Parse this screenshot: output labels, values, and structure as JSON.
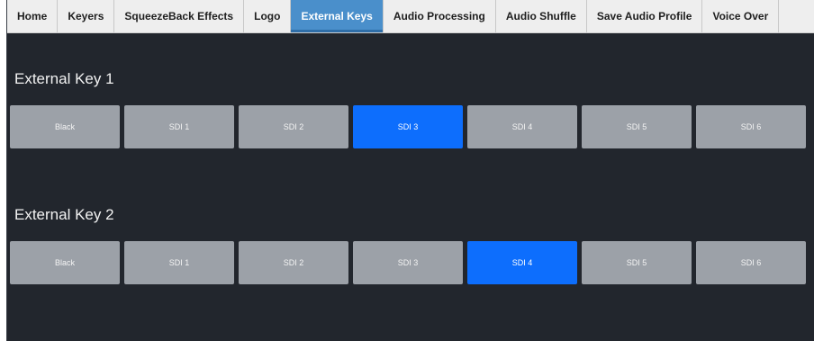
{
  "tabs": [
    {
      "label": "Home",
      "active": false
    },
    {
      "label": "Keyers",
      "active": false
    },
    {
      "label": "SqueezeBack Effects",
      "active": false
    },
    {
      "label": "Logo",
      "active": false
    },
    {
      "label": "External Keys",
      "active": true
    },
    {
      "label": "Audio Processing",
      "active": false
    },
    {
      "label": "Audio Shuffle",
      "active": false
    },
    {
      "label": "Save Audio Profile",
      "active": false
    },
    {
      "label": "Voice Over",
      "active": false
    }
  ],
  "external_key_1": {
    "title": "External Key 1",
    "sources": [
      "Black",
      "SDI 1",
      "SDI 2",
      "SDI 3",
      "SDI 4",
      "SDI 5",
      "SDI 6"
    ],
    "selected": "SDI 3"
  },
  "external_key_2": {
    "title": "External Key 2",
    "sources": [
      "Black",
      "SDI 1",
      "SDI 2",
      "SDI 3",
      "SDI 4",
      "SDI 5",
      "SDI 6"
    ],
    "selected": "SDI 4"
  },
  "colors": {
    "background": "#22262d",
    "button": "#9ca1a8",
    "selected_button": "#0d6efd",
    "active_tab": "#4a8fcb"
  }
}
